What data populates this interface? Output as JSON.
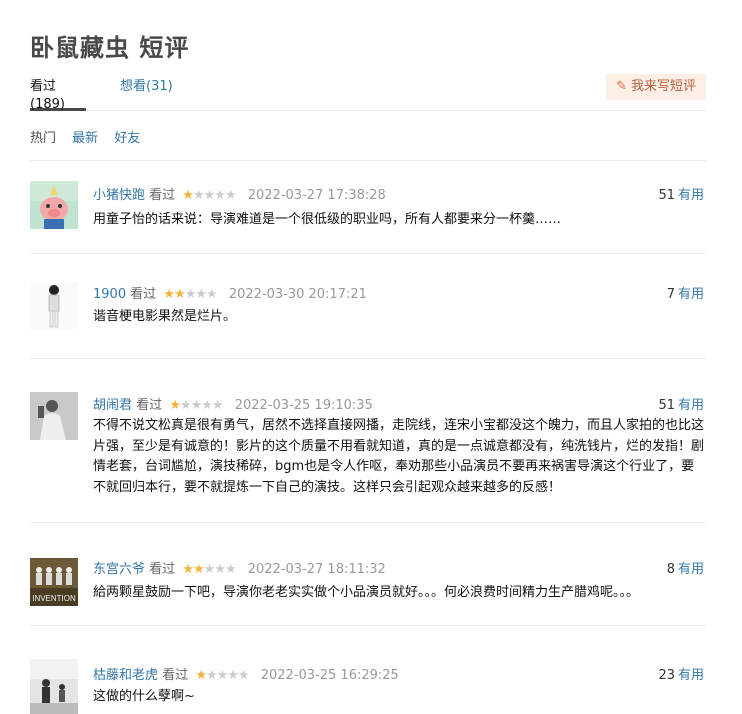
{
  "page": {
    "title": "卧鼠藏虫 短评"
  },
  "tabs": [
    {
      "label": "看过(189)",
      "active": true
    },
    {
      "label": "想看(31)",
      "active": false
    }
  ],
  "write_button": {
    "label": "我来写短评",
    "icon": "pencil-icon"
  },
  "filters": [
    {
      "label": "热门",
      "current": true
    },
    {
      "label": "最新",
      "current": false
    },
    {
      "label": "好友",
      "current": false
    }
  ],
  "comments": [
    {
      "user": "小猪快跑",
      "status": "看过",
      "rating": 1,
      "max_rating": 5,
      "time": "2022-03-27 17:38:28",
      "votes": "51",
      "useful": "有用",
      "text": "用童子怡的话来说：导演难道是一个很低级的职业吗，所有人都要来分一杯羹……"
    },
    {
      "user": "1900",
      "status": "看过",
      "rating": 2,
      "max_rating": 5,
      "time": "2022-03-30 20:17:21",
      "votes": "7",
      "useful": "有用",
      "text": "谐音梗电影果然是烂片。"
    },
    {
      "user": "胡闹君",
      "status": "看过",
      "rating": 1,
      "max_rating": 5,
      "time": "2022-03-25 19:10:35",
      "votes": "51",
      "useful": "有用",
      "text": "不得不说文松真是很有勇气，居然不选择直接网播，走院线，连宋小宝都没这个魄力，而且人家拍的也比这片强，至少是有诚意的！影片的这个质量不用看就知道，真的是一点诚意都没有，纯洗钱片，烂的发指！剧情老套，台词尴尬，演技稀碎，bgm也是令人作呕，奉劝那些小品演员不要再来祸害导演这个行业了，要不就回归本行，要不就提炼一下自己的演技。这样只会引起观众越来越多的反感！"
    },
    {
      "user": "东宫六爷",
      "status": "看过",
      "rating": 2,
      "max_rating": 5,
      "time": "2022-03-27 18:11:32",
      "votes": "8",
      "useful": "有用",
      "text": "給两颗星鼓励一下吧，导演你老老实实做个小品演员就好。。。何必浪费时间精力生产腊鸡呢。。。",
      "avatar_text": "INVENTION"
    },
    {
      "user": "枯藤和老虎",
      "status": "看过",
      "rating": 1,
      "max_rating": 5,
      "time": "2022-03-25 16:29:25",
      "votes": "23",
      "useful": "有用",
      "text": "这做的什么孽啊~"
    }
  ]
}
